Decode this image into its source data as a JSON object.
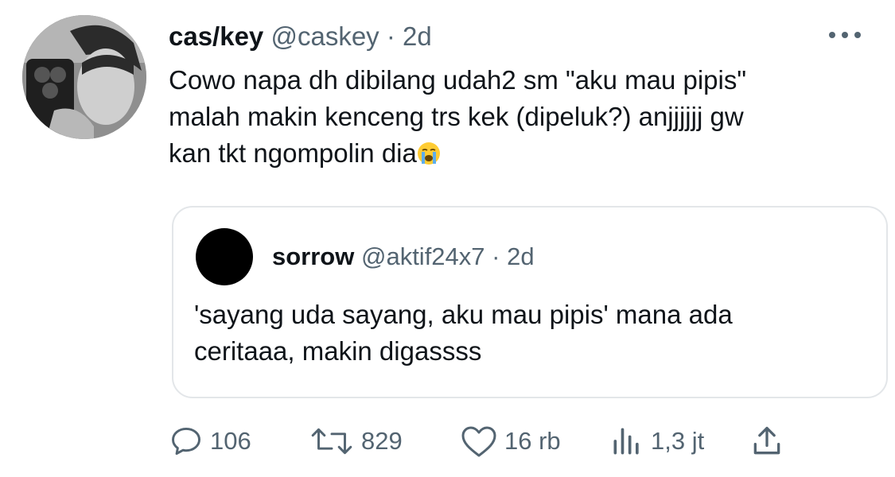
{
  "tweet": {
    "author_name": "cas/key",
    "handle": "@caskey",
    "separator": "·",
    "time": "2d",
    "text_lines": [
      "Cowo napa dh dibilang udah2 sm \"aku mau pipis\"",
      "malah makin kenceng trs kek (dipeluk?) anjjjjjj gw",
      "kan tkt ngompolin dia"
    ],
    "emoji": "loudly-crying-face"
  },
  "quoted_tweet": {
    "author_name": "sorrow",
    "handle": "@aktif24x7",
    "separator": "·",
    "time": "2d",
    "text_lines": [
      "'sayang uda sayang, aku mau pipis' mana ada",
      "ceritaaa, makin digassss"
    ]
  },
  "actions": {
    "replies": "106",
    "retweets": "829",
    "likes": "16 rb",
    "views": "1,3 jt"
  },
  "colors": {
    "text": "#0f1419",
    "secondary": "#536471",
    "border": "#e3e6e9"
  }
}
